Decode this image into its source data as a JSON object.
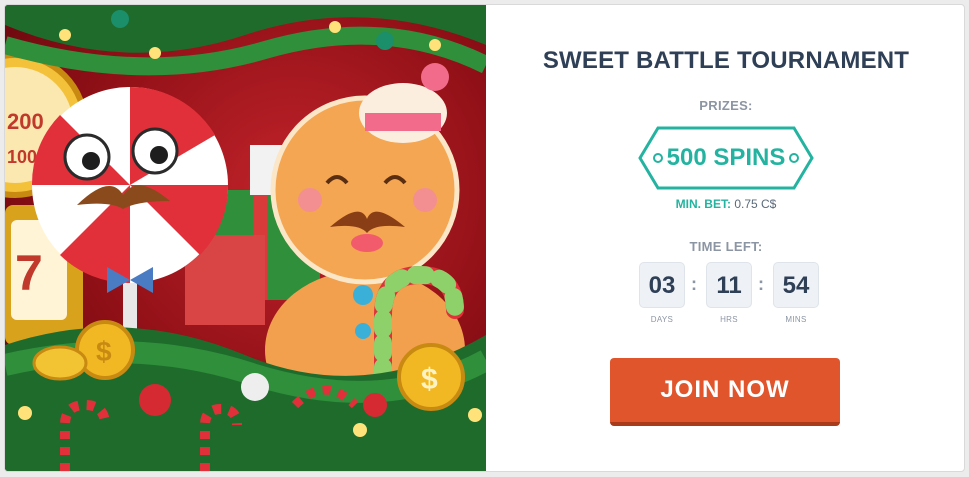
{
  "tournament": {
    "title": "SWEET BATTLE TOURNAMENT",
    "prizes_label": "PRIZES:",
    "prize_value": "500 SPINS",
    "min_bet_label": "MIN. BET:",
    "min_bet_value": "0.75 C$"
  },
  "countdown": {
    "label": "TIME LEFT:",
    "days": "03",
    "hours": "11",
    "mins": "54",
    "days_caption": "DAYS",
    "hours_caption": "HRS",
    "mins_caption": "MINS",
    "separator": ":"
  },
  "actions": {
    "join_label": "JOIN NOW"
  },
  "banner": {
    "wheel_numbers": [
      "200",
      "100"
    ],
    "slot_symbol": "7",
    "coin_symbol": "$"
  },
  "colors": {
    "title": "#2e3f56",
    "accent_teal": "#24b3a0",
    "button": "#e0552c",
    "banner_red": "#c2232a"
  }
}
